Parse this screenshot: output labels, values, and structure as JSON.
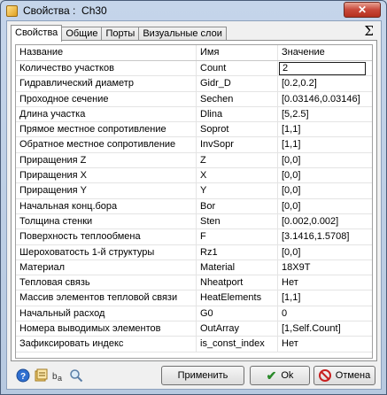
{
  "window": {
    "title": "Свойства :  Ch30",
    "close_label": "✕"
  },
  "tabs": [
    {
      "label": "Свойства"
    },
    {
      "label": "Общие"
    },
    {
      "label": "Порты"
    },
    {
      "label": "Визуальные слои"
    }
  ],
  "sigma_label": "Σ",
  "grid": {
    "headers": {
      "name": "Название",
      "id": "Имя",
      "value": "Значение"
    },
    "rows": [
      {
        "name": "Количество участков",
        "id": "Count",
        "value": "2"
      },
      {
        "name": "Гидравлический диаметр",
        "id": "Gidr_D",
        "value": "[0.2,0.2]"
      },
      {
        "name": "Проходное сечение",
        "id": "Sechen",
        "value": "[0.03146,0.03146]"
      },
      {
        "name": "Длина участка",
        "id": "Dlina",
        "value": "[5,2.5]"
      },
      {
        "name": "Прямое местное сопротивление",
        "id": "Soprot",
        "value": "[1,1]"
      },
      {
        "name": "Обратное местное сопротивление",
        "id": "InvSopr",
        "value": "[1,1]"
      },
      {
        "name": "Приращения Z",
        "id": "Z",
        "value": "[0,0]"
      },
      {
        "name": "Приращения X",
        "id": "X",
        "value": "[0,0]"
      },
      {
        "name": "Приращения Y",
        "id": "Y",
        "value": "[0,0]"
      },
      {
        "name": "Начальная конц.бора",
        "id": "Bor",
        "value": "[0,0]"
      },
      {
        "name": "Толщина стенки",
        "id": "Sten",
        "value": "[0.002,0.002]"
      },
      {
        "name": "Поверхность теплообмена",
        "id": "F",
        "value": "[3.1416,1.5708]"
      },
      {
        "name": "Шероховатость 1-й структуры",
        "id": "Rz1",
        "value": "[0,0]"
      },
      {
        "name": "Материал",
        "id": "Material",
        "value": "18Х9Т"
      },
      {
        "name": "Тепловая связь",
        "id": "Nheatport",
        "value": "Нет"
      },
      {
        "name": "Массив элементов тепловой связи",
        "id": "HeatElements",
        "value": "[1,1]"
      },
      {
        "name": "Начальный расход",
        "id": "G0",
        "value": "0"
      },
      {
        "name": "Номера выводимых элементов",
        "id": "OutArray",
        "value": "[1,Self.Count]"
      },
      {
        "name": "Зафиксировать индекс",
        "id": "is_const_index",
        "value": "Нет"
      }
    ]
  },
  "buttons": {
    "apply": "Применить",
    "ok": "Ok",
    "cancel": "Отмена"
  },
  "toolbar_icons": [
    "help-icon",
    "properties-icon",
    "rename-icon",
    "search-icon"
  ]
}
